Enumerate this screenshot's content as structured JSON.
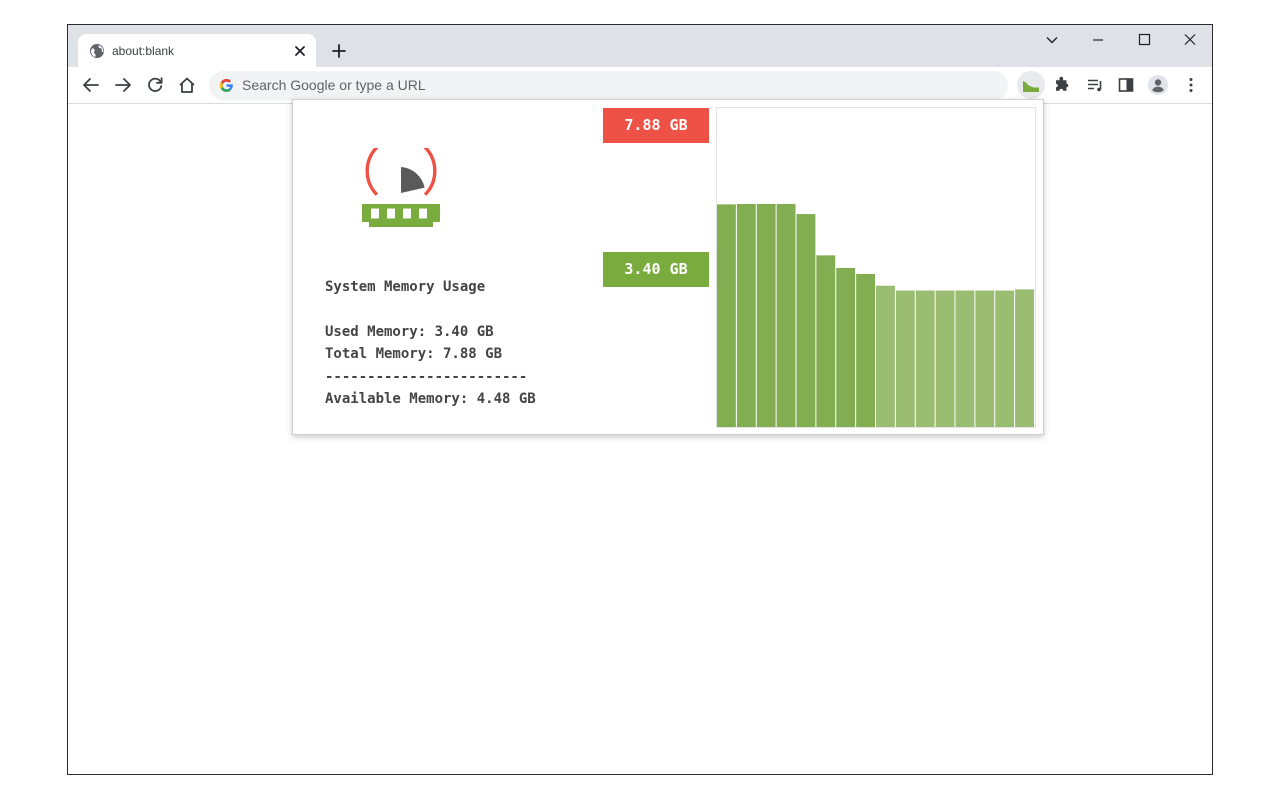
{
  "browser": {
    "tab_title": "about:blank",
    "omnibox_placeholder": "Search Google or type a URL"
  },
  "popup": {
    "title": "System Memory Usage",
    "used_line": "Used Memory: 3.40 GB",
    "total_line": "Total Memory: 7.88 GB",
    "separator": "------------------------",
    "available_line": "Available Memory: 4.48 GB",
    "total_badge": "7.88 GB",
    "used_badge": "3.40 GB",
    "colors": {
      "total": "#ee5247",
      "used": "#7aab3f",
      "bar_dark": "#82ad51",
      "bar_light": "#9bbd72"
    }
  },
  "chart_data": {
    "type": "bar",
    "ylim": [
      0,
      7.88
    ],
    "values": [
      5.5,
      5.51,
      5.51,
      5.51,
      5.26,
      4.24,
      3.93,
      3.78,
      3.49,
      3.37,
      3.37,
      3.37,
      3.37,
      3.37,
      3.37,
      3.4
    ]
  }
}
